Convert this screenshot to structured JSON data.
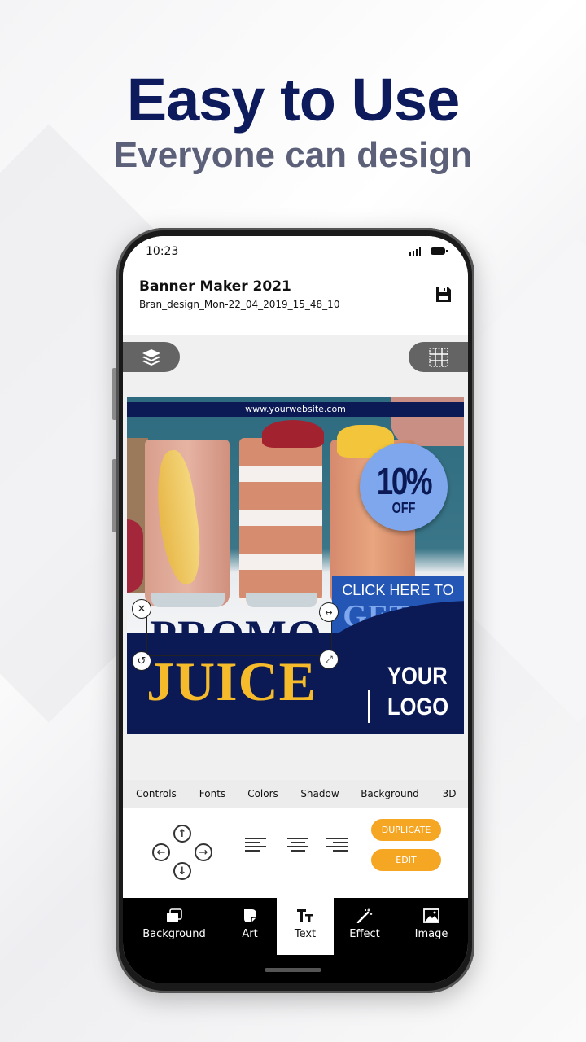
{
  "promo": {
    "headline": "Easy to Use",
    "subline": "Everyone can design"
  },
  "status_bar": {
    "time": "10:23"
  },
  "app_bar": {
    "title": "Banner Maker 2021",
    "filename": "Bran_design_Mon-22_04_2019_15_48_10",
    "save_icon": "floppy-save-icon"
  },
  "canvas_tools": {
    "layers_icon": "layers-icon",
    "grid_icon": "grid-icon"
  },
  "banner": {
    "website": "www.yourwebsite.com",
    "discount_value": "10%",
    "discount_label": "OFF",
    "cta_small": "CLICK HERE TO",
    "cta_big": "GET IT",
    "promo_word": "PROMO",
    "juice_word": "JUICE",
    "logo_line1": "YOUR",
    "logo_line2": "LOGO",
    "colors": {
      "navy": "#0b1a55",
      "yellow": "#f5bb2a",
      "light_blue": "#7ea7ee",
      "cta_blue": "#2456b6"
    }
  },
  "selection_handles": {
    "delete": "close-icon",
    "stretch": "resize-horizontal-icon",
    "rotate": "rotate-icon",
    "scale": "expand-icon"
  },
  "tabs": [
    {
      "label": "Controls",
      "active": true
    },
    {
      "label": "Fonts",
      "active": false
    },
    {
      "label": "Colors",
      "active": false
    },
    {
      "label": "Shadow",
      "active": false
    },
    {
      "label": "Background",
      "active": false
    },
    {
      "label": "3D",
      "active": false
    }
  ],
  "controls": {
    "move_up": "arrow-up-icon",
    "move_down": "arrow-down-icon",
    "move_left": "arrow-left-icon",
    "move_right": "arrow-right-icon",
    "align_left": "align-left-icon",
    "align_center": "align-center-icon",
    "align_right": "align-right-icon",
    "duplicate_label": "DUPLICATE",
    "edit_label": "EDIT",
    "accent": "#f5a623"
  },
  "bottom_nav": [
    {
      "label": "Background",
      "icon": "background-layers-icon",
      "active": false
    },
    {
      "label": "Art",
      "icon": "sticker-icon",
      "active": false
    },
    {
      "label": "Text",
      "icon": "text-icon",
      "active": true
    },
    {
      "label": "Effect",
      "icon": "magic-wand-icon",
      "active": false
    },
    {
      "label": "Image",
      "icon": "image-icon",
      "active": false
    }
  ]
}
